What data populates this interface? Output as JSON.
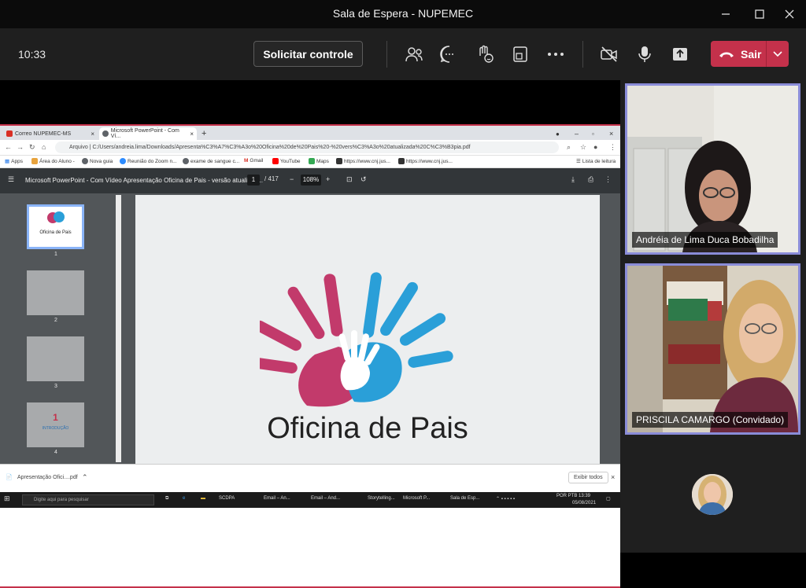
{
  "window": {
    "title": "Sala de Espera - NUPEMEC"
  },
  "toolbar": {
    "clock": "10:33",
    "request_control_label": "Solicitar controle",
    "leave_label": "Sair",
    "leave_color": "#c4314b"
  },
  "share": {
    "tabs": [
      {
        "label": "Correo NUPEMEC-MS"
      },
      {
        "label": "Microsoft PowerPoint - Com Ví..."
      }
    ],
    "address": "Arquivo | C:/Users/andreia.lima/Downloads/Apresenta%C3%A7%C3%A3o%20Oficina%20de%20Pais%20-%20vers%C3%A3o%20atualizada%20C%C3%B3pia.pdf",
    "bookmarks": [
      "Apps",
      "Área do Aluno -",
      "Nova guia",
      "Reunião do Zoom n...",
      "exame de sangue c...",
      "Gmail",
      "YouTube",
      "Maps",
      "https://www.cnj.jus...",
      "https://www.cnj.jus...",
      "Lista de leitura"
    ],
    "pdf": {
      "title": "Microsoft PowerPoint - Com Vídeo Apresentação Oficina de Pais - versão atualizad...",
      "page": "1",
      "total": "/ 417",
      "zoom": "108%"
    },
    "thumbs": [
      {
        "num": "1",
        "title": "Oficina de Pais"
      },
      {
        "num": "2"
      },
      {
        "num": "3"
      },
      {
        "num": "4",
        "title": "1",
        "subtitle": "INTRODUÇÃO"
      }
    ],
    "slide_title": "Oficina de Pais",
    "download": {
      "file": "Apresentação Ofici....pdf",
      "show_all": "Exibir todos"
    },
    "taskbar": {
      "search": "Digite aqui para pesquisar",
      "apps": [
        "SCDPA",
        "Email – An...",
        "Email – And...",
        "Storytelling...",
        "Microsoft P...",
        "Sala de Esp..."
      ],
      "lang": "POR PTB",
      "time": "13:39",
      "date": "05/08/2021"
    }
  },
  "speaker": {
    "name": "Andréia de Lima Duca Bobadilha"
  },
  "participants": [
    {
      "name": "Andréia de Lima Duca Bobadilha"
    },
    {
      "name": "PRISCILA CAMARGO (Convidado)"
    }
  ],
  "colors": {
    "tile_border": "#8a8cd8",
    "hand_pink": "#c23a6b",
    "hand_blue": "#2a9fd8"
  }
}
